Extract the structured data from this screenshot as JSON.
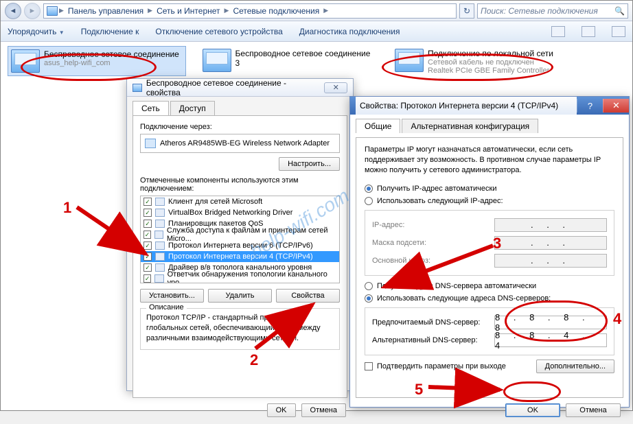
{
  "breadcrumb": [
    "Панель управления",
    "Сеть и Интернет",
    "Сетевые подключения"
  ],
  "search_placeholder": "Поиск: Сетевые подключения",
  "toolbar": {
    "organize": "Упорядочить",
    "connect": "Подключение к",
    "disable": "Отключение сетевого устройства",
    "diagnose": "Диагностика подключения"
  },
  "connections": [
    {
      "name": "Беспроводное сетевое соединение",
      "sub": "asus_help-wifi_com"
    },
    {
      "name": "Беспроводное сетевое соединение 3",
      "sub": ""
    },
    {
      "name": "Подключение по локальной сети",
      "sub1": "Сетевой кабель не подключен",
      "sub2": "Realtek PCIe GBE Family Controller"
    }
  ],
  "dlg1": {
    "title": "Беспроводное сетевое соединение - свойства",
    "tab_net": "Сеть",
    "tab_access": "Доступ",
    "connect_via": "Подключение через:",
    "adapter": "Atheros AR9485WB-EG Wireless Network Adapter",
    "configure": "Настроить...",
    "components_label": "Отмеченные компоненты используются этим подключением:",
    "components": [
      "Клиент для сетей Microsoft",
      "VirtualBox Bridged Networking Driver",
      "Планировщик пакетов QoS",
      "Служба доступа к файлам и принтерам сетей Micro...",
      "Протокол Интернета версии 6 (TCP/IPv6)",
      "Протокол Интернета версии 4 (TCP/IPv4)",
      "Драйвер в/в тополога канального уровня",
      "Ответчик обнаружения топологии канального уро..."
    ],
    "install": "Установить...",
    "remove": "Удалить",
    "props": "Свойства",
    "desc_title": "Описание",
    "desc": "Протокол TCP/IP - стандартный протокол глобальных сетей, обеспечивающий связь между различными взаимодействующими сетями.",
    "ok": "OK",
    "cancel": "Отмена"
  },
  "dlg2": {
    "title": "Свойства: Протокол Интернета версии 4 (TCP/IPv4)",
    "tab_general": "Общие",
    "tab_alt": "Альтернативная конфигурация",
    "info": "Параметры IP могут назначаться автоматически, если сеть поддерживает эту возможность. В противном случае параметры IP можно получить у сетевого администратора.",
    "auto_ip": "Получить IP-адрес автоматически",
    "manual_ip": "Использовать следующий IP-адрес:",
    "ip_addr": "IP-адрес:",
    "mask": "Маска подсети:",
    "gateway": "Основной шлюз:",
    "auto_dns": "Получить адрес DNS-сервера автоматически",
    "manual_dns": "Использовать следующие адреса DNS-серверов:",
    "pref_dns": "Предпочитаемый DNS-сервер:",
    "alt_dns": "Альтернативный DNS-сервер:",
    "pref_dns_val": "8 . 8 . 8 . 8",
    "alt_dns_val": "8 . 8 . 4 . 4",
    "confirm_exit": "Подтвердить параметры при выходе",
    "advanced": "Дополнительно...",
    "ok": "OK",
    "cancel": "Отмена"
  },
  "annotations": {
    "n1": "1",
    "n2": "2",
    "n3": "3",
    "n4": "4",
    "n5": "5"
  }
}
